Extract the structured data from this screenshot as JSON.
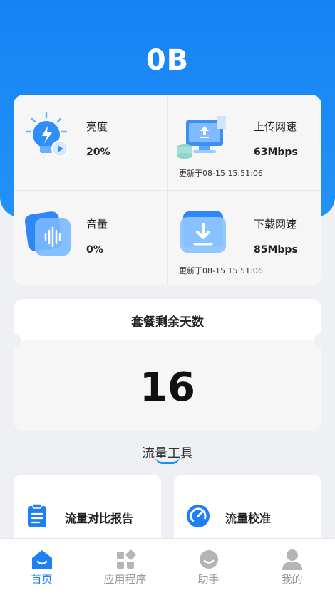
{
  "hero": {
    "value": "0B"
  },
  "status": {
    "brightness": {
      "title": "亮度",
      "value": "20%"
    },
    "upload": {
      "title": "上传网速",
      "value": "63Mbps",
      "updated": "更新于08-15 15:51:06"
    },
    "volume": {
      "title": "音量",
      "value": "0%"
    },
    "download": {
      "title": "下载网速",
      "value": "85Mbps",
      "updated": "更新于08-15 15:51:06"
    }
  },
  "plan": {
    "title": "套餐剩余天数",
    "days": "16"
  },
  "tools": {
    "section_title": "流量工具",
    "items": [
      {
        "label": "流量对比报告",
        "icon": "clipboard-icon"
      },
      {
        "label": "流量校准",
        "icon": "speedometer-icon"
      }
    ]
  },
  "tabbar": {
    "active_color": "#1f7ff5",
    "inactive_color": "#9a9a9a",
    "items": [
      {
        "label": "首页",
        "icon": "home-icon",
        "active": true
      },
      {
        "label": "应用程序",
        "icon": "apps-icon",
        "active": false
      },
      {
        "label": "助手",
        "icon": "assistant-icon",
        "active": false
      },
      {
        "label": "我的",
        "icon": "profile-icon",
        "active": false
      }
    ]
  }
}
